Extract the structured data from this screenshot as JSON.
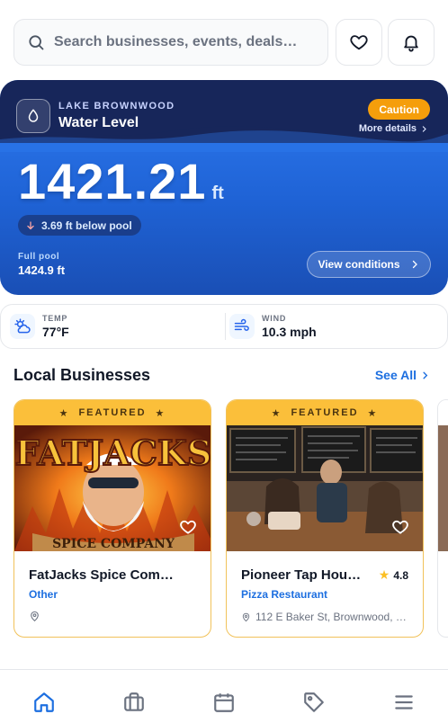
{
  "search": {
    "placeholder": "Search businesses, events, deals…"
  },
  "water": {
    "lake_name": "LAKE BROWNWOOD",
    "title": "Water Level",
    "status": "Caution",
    "more_details": "More details",
    "level_value": "1421.21",
    "level_unit": "ft",
    "below_pool": "3.69 ft below pool",
    "full_pool_label": "Full pool",
    "full_pool_value": "1424.9 ft",
    "view_button": "View conditions",
    "status_color": "#f59e0b"
  },
  "weather": {
    "temp_label": "TEMP",
    "temp_value": "77°F",
    "wind_label": "WIND",
    "wind_value": "10.3 mph"
  },
  "section": {
    "title": "Local Businesses",
    "see_all": "See All"
  },
  "businesses": [
    {
      "featured": "FEATURED",
      "name": "FatJacks Spice Com…",
      "category": "Other",
      "address": "",
      "rating": ""
    },
    {
      "featured": "FEATURED",
      "name": "Pioneer Tap Hou…",
      "category": "Pizza Restaurant",
      "address": "112 E Baker St, Brownwood, …",
      "rating": "4.8"
    }
  ],
  "nav": [
    "home-icon",
    "briefcase-icon",
    "calendar-icon",
    "tag-icon",
    "menu-icon"
  ],
  "colors": {
    "accent": "#1d6fe0",
    "featured": "#fbbf3a",
    "card_border": "#f1c25a",
    "water_dark": "#17265a"
  }
}
